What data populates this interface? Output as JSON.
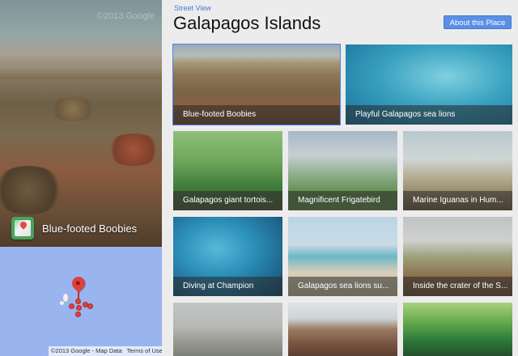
{
  "panorama": {
    "watermark": "©2013 Google",
    "place_name": "Blue-footed Boobies"
  },
  "map": {
    "copyright": "©2013 Google - Map Data",
    "terms": "Terms of Use"
  },
  "header": {
    "breadcrumb": "Street View",
    "title": "Galapagos Islands",
    "about_button": "About this Place"
  },
  "tiles": [
    {
      "caption": "Blue-footed Boobies",
      "selected": true
    },
    {
      "caption": "Playful Galapagos sea lions"
    },
    {
      "caption": "Galapagos giant tortois..."
    },
    {
      "caption": "Magnificent Frigatebird"
    },
    {
      "caption": "Marine Iguanas in Hum..."
    },
    {
      "caption": "Diving at Champion"
    },
    {
      "caption": "Galapagos sea lions su..."
    },
    {
      "caption": "Inside the crater of the S..."
    },
    {
      "caption": ""
    },
    {
      "caption": ""
    },
    {
      "caption": ""
    }
  ],
  "colors": {
    "accent": "#4a84ee",
    "button": "#5b8fe6",
    "map_water": "#9ab4f0",
    "pin": "#e0413a"
  }
}
